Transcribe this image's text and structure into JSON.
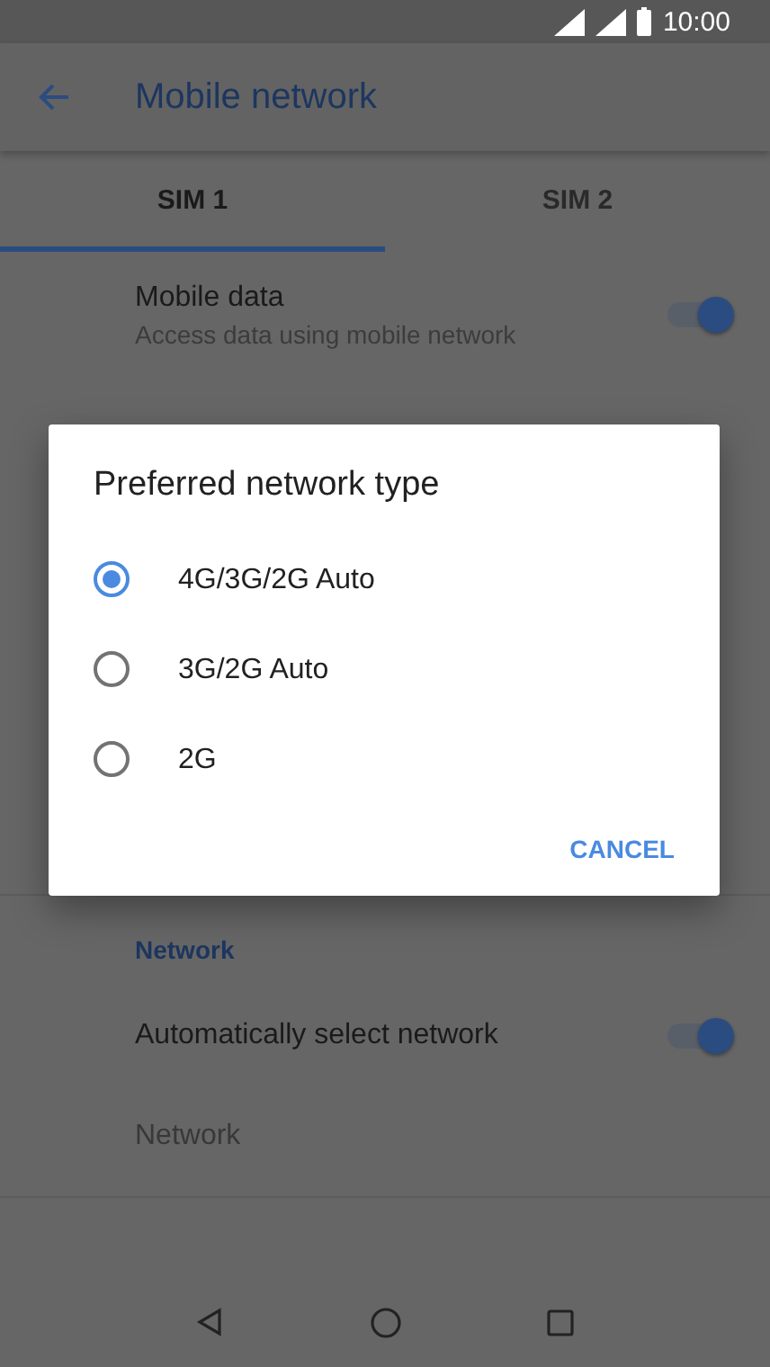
{
  "status_bar": {
    "time": "10:00"
  },
  "app_bar": {
    "title": "Mobile network"
  },
  "tabs": [
    {
      "label": "SIM 1",
      "selected": true
    },
    {
      "label": "SIM 2",
      "selected": false
    }
  ],
  "sections": [
    {
      "items": [
        {
          "kind": "toggle",
          "title": "Mobile data",
          "subtitle": "Access data using mobile network",
          "on": true
        }
      ]
    },
    {
      "items": [
        {
          "kind": "header",
          "title": "Network"
        },
        {
          "kind": "toggle",
          "title": "Automatically select network",
          "on": true
        },
        {
          "kind": "item",
          "title": "Network",
          "disabled": true
        }
      ]
    }
  ],
  "dialog": {
    "title": "Preferred network type",
    "options": [
      {
        "label": "4G/3G/2G Auto",
        "selected": true
      },
      {
        "label": "3G/2G Auto",
        "selected": false
      },
      {
        "label": "2G",
        "selected": false
      }
    ],
    "buttons": [
      "CANCEL"
    ]
  }
}
